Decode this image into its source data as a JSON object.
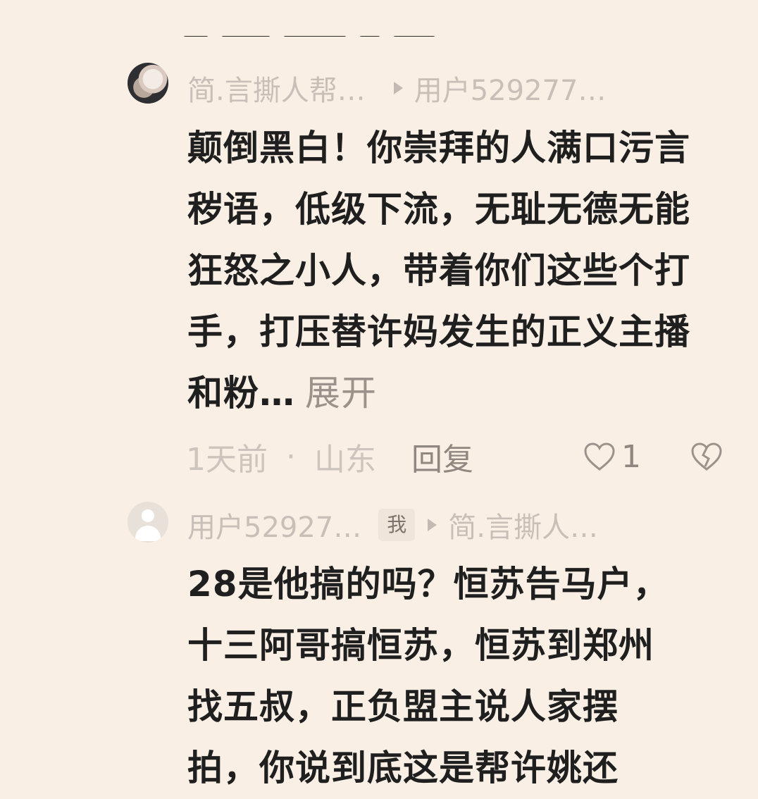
{
  "comments": [
    {
      "author": "简.言撕人帮…",
      "reply_to": "用户529277…",
      "is_me": false,
      "text": "颠倒黑白！你崇拜的人满口污言秽语，低级下流，无耻无德无能狂怒之小人，带着你们这些个打手，打压替许妈发生的正义主播和粉…",
      "expand_label": "展开",
      "time": "1天前",
      "location": "山东",
      "reply_label": "回复",
      "likes": "1"
    },
    {
      "author": "用户52927…",
      "me_badge": "我",
      "reply_to": "简.言撕人…",
      "text": "28是他搞的吗？恒苏告马户，十三阿哥搞恒苏，恒苏到郑州找五叔，正负盟主说人家摆拍，你说到底这是帮许姚还"
    }
  ],
  "meta_separator": "·",
  "icons": {
    "avatar_1": "user-avatar-photo",
    "avatar_2": "default-user-avatar",
    "reply_arrow": "triangle-right-icon",
    "like": "heart-outline-icon",
    "dislike": "broken-heart-icon"
  },
  "colors": {
    "background": "#f9efe5",
    "text": "#1f1f1f",
    "muted": "#c8c0b8",
    "action": "#8f8780"
  }
}
